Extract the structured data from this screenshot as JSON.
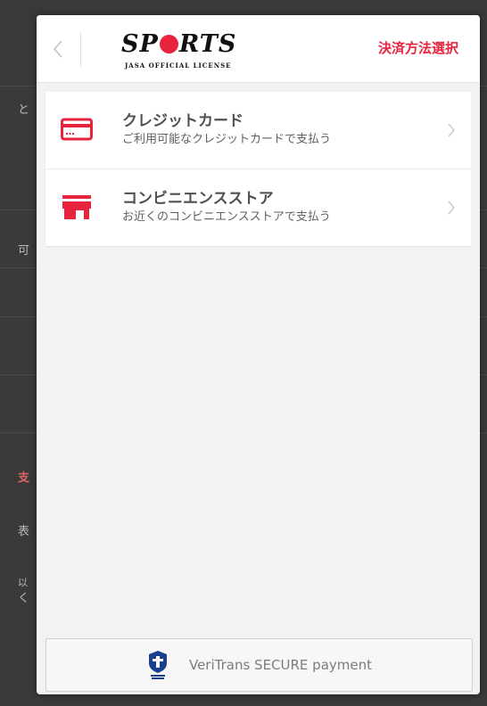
{
  "background": {
    "fragments": [
      "と",
      "可",
      "支",
      "表",
      "以",
      "く"
    ]
  },
  "modal": {
    "logo": {
      "main_left": "SP",
      "main_right": "RTS",
      "sub": "JASA OFFICIAL LICENSE"
    },
    "title": "決済方法選択",
    "accent_color": "#e8233e",
    "methods": [
      {
        "icon": "credit-card-icon",
        "title": "クレジットカード",
        "description": "ご利用可能なクレジットカードで支払う"
      },
      {
        "icon": "store-icon",
        "title": "コンビニエンスストア",
        "description": "お近くのコンビニエンスストアで支払う"
      }
    ],
    "footer": {
      "text": "VeriTrans SECURE payment",
      "icon": "secure-payment-icon"
    }
  }
}
